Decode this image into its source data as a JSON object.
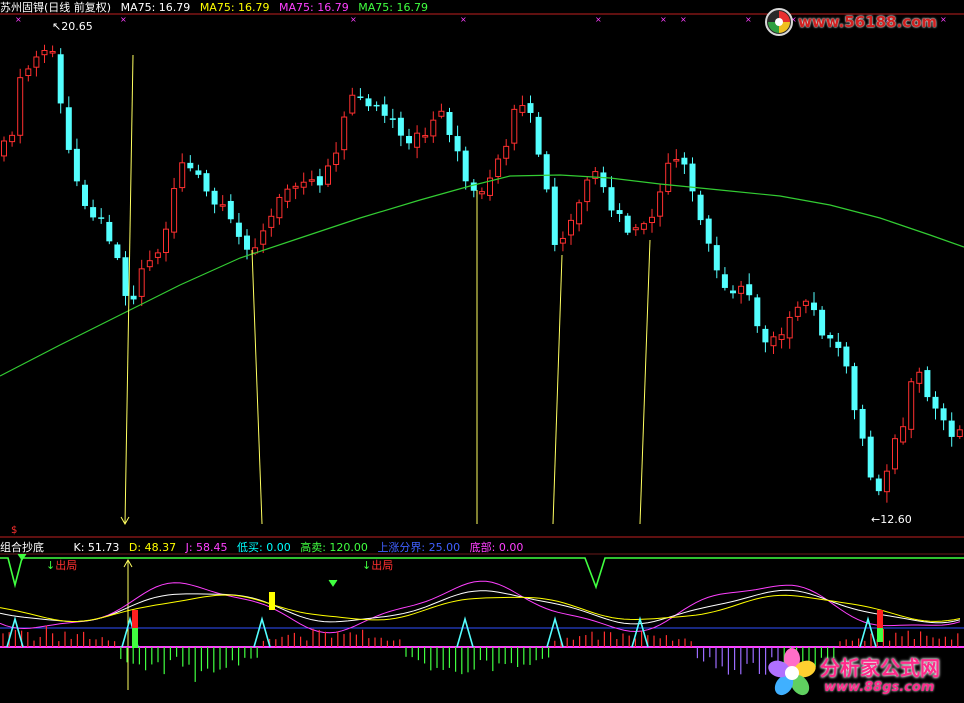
{
  "main_header": {
    "title": "苏州固锝(日线 前复权)",
    "ma_items": [
      {
        "label": "MA75: 16.79",
        "color": "#ffffff"
      },
      {
        "label": "MA75: 16.79",
        "color": "#ffff00"
      },
      {
        "label": "MA75: 16.79",
        "color": "#ff40ff"
      },
      {
        "label": "MA75: 16.79",
        "color": "#40ff40"
      }
    ]
  },
  "price_labels": {
    "high": "20.65",
    "low": "12.60"
  },
  "indicator_header": {
    "name": "组合抄底",
    "items": [
      {
        "label": "K: 51.73",
        "color": "#ffffff"
      },
      {
        "label": "D: 48.37",
        "color": "#ffff00"
      },
      {
        "label": "J: 58.45",
        "color": "#ff40ff"
      },
      {
        "label": "低买: 0.00",
        "color": "#00ffff"
      },
      {
        "label": "高卖: 120.00",
        "color": "#40ff40"
      },
      {
        "label": "上涨分界: 25.00",
        "color": "#4060ff"
      },
      {
        "label": "底部: 0.00",
        "color": "#ff40ff"
      }
    ]
  },
  "signals": {
    "exit_label": "出局",
    "dollar": "$"
  },
  "watermarks": {
    "top_site": "www.56188.com",
    "bottom_name": "分析家公式网",
    "bottom_site": "www.88gs.com"
  },
  "colors": {
    "up": "#ff3030",
    "down": "#54ffff",
    "ma": "#33cc33",
    "k": "#ffffff",
    "d": "#ffff00",
    "j": "#ff40ff",
    "axis": "#c02020"
  },
  "chart_data": {
    "type": "candlestick",
    "y_range_shown": [
      12.6,
      20.65
    ],
    "ma75_last": 16.79,
    "indicator_last": {
      "K": 51.73,
      "D": 48.37,
      "J": 58.45
    }
  }
}
